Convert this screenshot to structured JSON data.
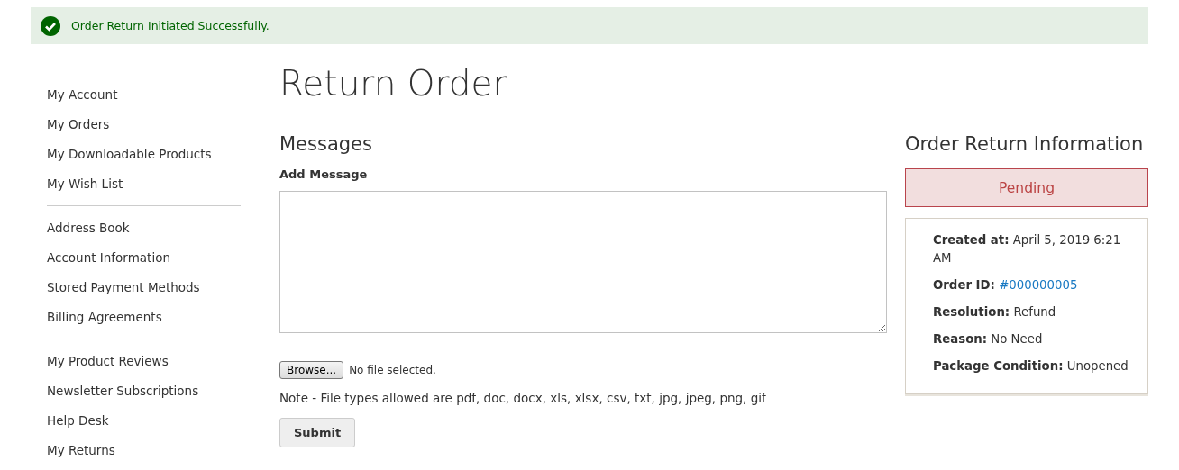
{
  "notice": {
    "kind": "success",
    "text": "Order Return Initiated Successfully."
  },
  "sidebar": {
    "groups": [
      [
        "My Account",
        "My Orders",
        "My Downloadable Products",
        "My Wish List"
      ],
      [
        "Address Book",
        "Account Information",
        "Stored Payment Methods",
        "Billing Agreements"
      ],
      [
        "My Product Reviews",
        "Newsletter Subscriptions",
        "Help Desk",
        "My Returns"
      ]
    ]
  },
  "page_title": "Return Order",
  "messages": {
    "title": "Messages",
    "field_label": "Add Message",
    "file_button": "Browse...",
    "file_status": "No file selected.",
    "note": "Note - File types allowed are pdf, doc, docx, xls, xlsx, csv, txt, jpg, jpeg, png, gif",
    "submit": "Submit"
  },
  "info": {
    "title": "Order Return Information",
    "status": "Pending",
    "rows": [
      {
        "label": "Created at:",
        "value": "April 5, 2019 6:21 AM",
        "link": false
      },
      {
        "label": "Order ID:",
        "value": "#000000005",
        "link": true
      },
      {
        "label": "Resolution:",
        "value": "Refund",
        "link": false
      },
      {
        "label": "Reason:",
        "value": "No Need",
        "link": false
      },
      {
        "label": "Package Condition:",
        "value": "Unopened",
        "link": false
      }
    ]
  }
}
